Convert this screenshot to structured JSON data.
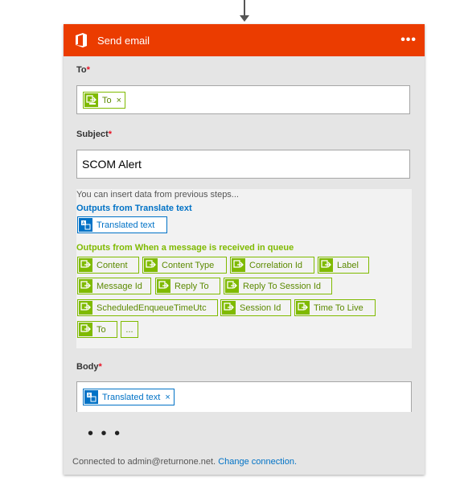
{
  "card": {
    "title": "Send email",
    "more_label": "•••",
    "icon": "office-icon",
    "accent_color": "#eb3c00"
  },
  "to": {
    "label": "To",
    "required_mark": "*",
    "token": {
      "label": "To",
      "remove": "×",
      "icon": "dynamic-content-icon"
    }
  },
  "subject": {
    "label": "Subject",
    "required_mark": "*",
    "value": "SCOM Alert"
  },
  "dynamic": {
    "hint": "You can insert data from previous steps...",
    "translate_section": "Outputs from Translate text",
    "translate_items": [
      "Translated text"
    ],
    "queue_section": "Outputs from When a message is received in queue",
    "queue_items": [
      "Content",
      "Content Type",
      "Correlation Id",
      "Label",
      "Message Id",
      "Reply To",
      "Reply To Session Id",
      "ScheduledEnqueueTimeUtc",
      "Session Id",
      "Time To Live",
      "To"
    ],
    "more_label": "..."
  },
  "body": {
    "label": "Body",
    "required_mark": "*",
    "token": {
      "label": "Translated text",
      "remove": "×",
      "icon": "translate-icon"
    }
  },
  "ellipsis": "• • •",
  "footer": {
    "text": "Connected to admin@returnone.net.",
    "link": "Change connection."
  },
  "colors": {
    "green": "#7fba00",
    "blue": "#0072c6",
    "required": "#e81123"
  }
}
